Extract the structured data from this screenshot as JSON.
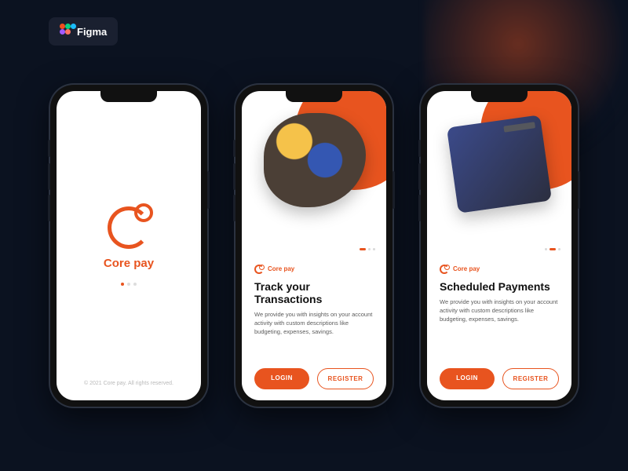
{
  "figma": {
    "label": "Figma"
  },
  "brand": {
    "name": "Core pay"
  },
  "splash": {
    "copyright": "© 2021 Core pay. All rights reserved."
  },
  "onboarding": {
    "login_label": "LOGIN",
    "register_label": "REGISTER",
    "body_text": "We provide you with insights on your account activity with custom descriptions like budgeting, expenses, savings.",
    "screens": [
      {
        "title": "Track your Transactions"
      },
      {
        "title": "Scheduled Payments"
      }
    ]
  },
  "colors": {
    "accent": "#e8541f",
    "bg": "#0b1220"
  }
}
